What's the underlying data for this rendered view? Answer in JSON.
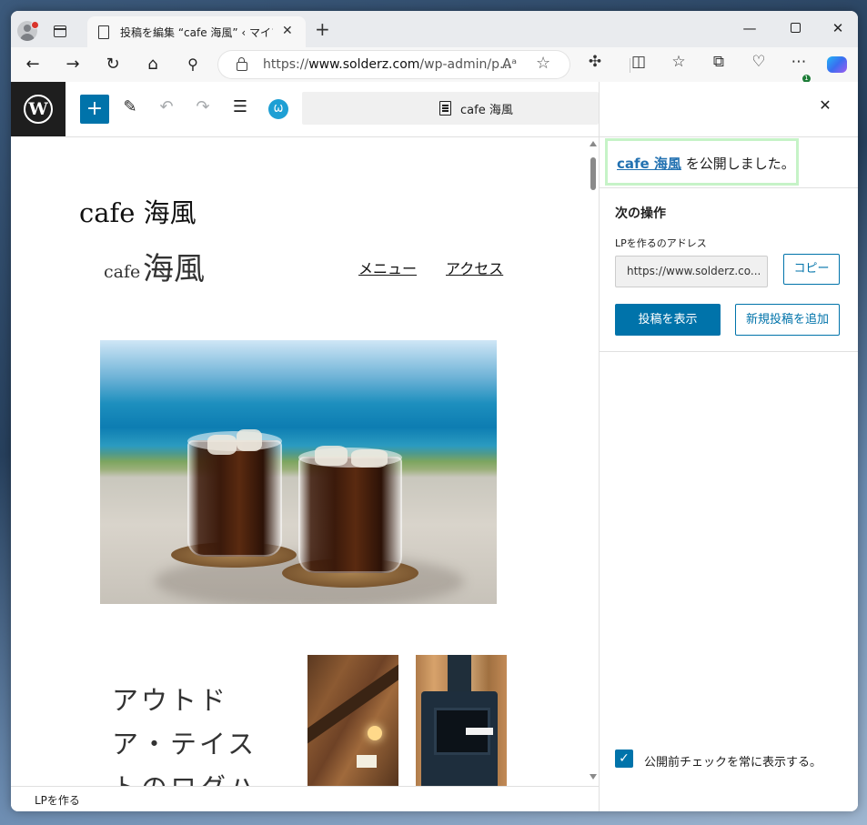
{
  "browser": {
    "tab_title": "投稿を編集 “cafe 海風” ‹ マイブログ",
    "url_prefix": "https://",
    "url_domain": "www.solderz.com",
    "url_path": "/wp-admin/p...",
    "icons": {
      "back": "←",
      "forward": "→",
      "refresh": "↻",
      "home": "⌂",
      "search": "⚲",
      "read_aloud": "Aᵃ",
      "favorite": "☆",
      "extensions": "✣",
      "split": "◫",
      "favorites": "☆",
      "collections": "⧉",
      "performance": "♡",
      "more": "⋯",
      "close": "✕",
      "minimize": "—",
      "new_tab": "+"
    },
    "badge": "1"
  },
  "editor": {
    "doc_title": "cafe 海風",
    "add_symbol": "+",
    "tools": {
      "pen": "✎",
      "undo": "↶",
      "redo": "↷",
      "list": "☰",
      "jetpack": "Ѡ"
    }
  },
  "canvas": {
    "site_title": "cafe 海風",
    "logo_small": "cafe",
    "logo_big": "海風",
    "nav": [
      "メニュー",
      "アクセス"
    ],
    "outdoor_text": "アウトドア・テイストのログハ"
  },
  "footer": {
    "breadcrumb": "LPを作る"
  },
  "sidebar": {
    "close": "✕",
    "published_link": "cafe 海風",
    "published_suffix": " を公開しました。",
    "next_title": "次の操作",
    "address_label": "LPを作るのアドレス",
    "address_value": "https://www.solderz.co...",
    "copy_label": "コピー",
    "view_label": "投稿を表示",
    "new_post_label": "新規投稿を追加",
    "checkbox_label": "公開前チェックを常に表示する。",
    "checkbox_mark": "✓"
  },
  "colors": {
    "wp_blue": "#0073aa",
    "highlight": "#c6f3c7",
    "link": "#2271b1"
  }
}
